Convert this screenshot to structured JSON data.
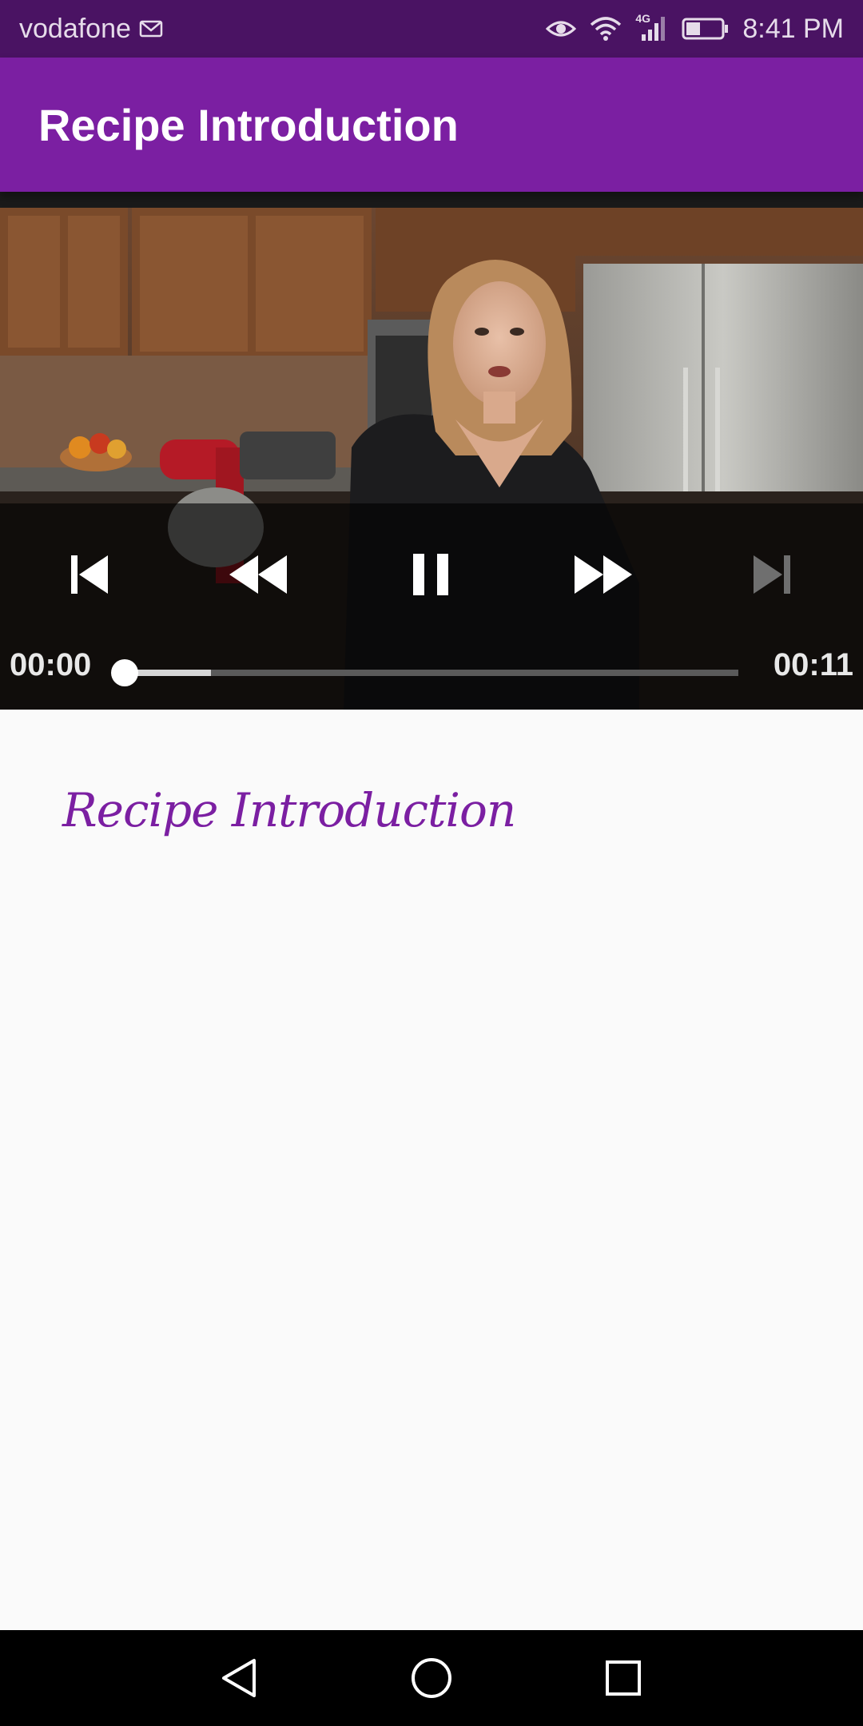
{
  "status_bar": {
    "carrier": "vodafone",
    "network_type": "4G",
    "time": "8:41 PM",
    "battery_level": 0.4,
    "icons": [
      "gmail-icon",
      "eye-icon",
      "wifi-icon",
      "signal-icon",
      "battery-icon"
    ]
  },
  "app_bar": {
    "title": "Recipe Introduction"
  },
  "player": {
    "current_time": "00:00",
    "total_time": "00:11",
    "progress": 0.0,
    "buffered": 0.14,
    "controls": [
      "previous-icon",
      "rewind-icon",
      "pause-icon",
      "fast-forward-icon",
      "next-icon"
    ],
    "next_enabled": false
  },
  "content": {
    "heading": "Recipe Introduction"
  },
  "nav_bar": {
    "buttons": [
      "back-icon",
      "home-icon",
      "recents-icon"
    ]
  },
  "colors": {
    "status_bar": "#4a1363",
    "app_bar": "#7b1fa2",
    "accent": "#7b1fa2",
    "background": "#fafafa"
  }
}
